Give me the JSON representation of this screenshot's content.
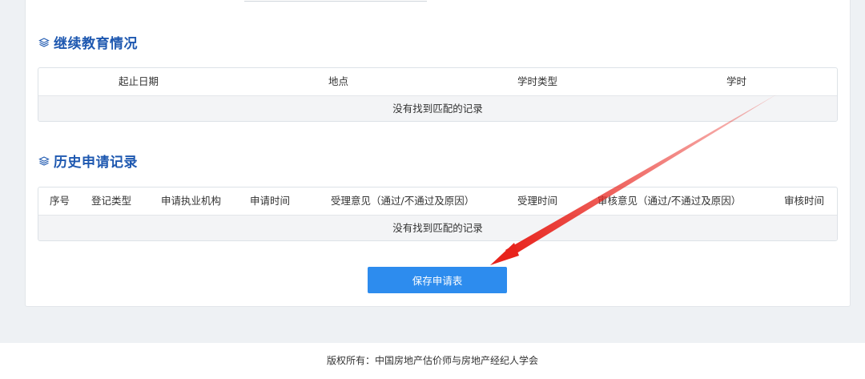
{
  "continuing_education": {
    "title": "继续教育情况",
    "columns": [
      "起止日期",
      "地点",
      "学时类型",
      "学时"
    ],
    "empty_text": "没有找到匹配的记录"
  },
  "history": {
    "title": "历史申请记录",
    "columns": [
      "序号",
      "登记类型",
      "申请执业机构",
      "申请时间",
      "受理意见（通过/不通过及原因）",
      "受理时间",
      "审核意见（通过/不通过及原因）",
      "审核时间"
    ],
    "empty_text": "没有找到匹配的记录"
  },
  "actions": {
    "save_label": "保存申请表"
  },
  "footer": {
    "copyright": "版权所有：中国房地产估价师与房地产经纪人学会"
  },
  "colors": {
    "section_title": "#1e58b0",
    "primary_button": "#2d8cee",
    "annotation_arrow": "#e8231c",
    "page_background": "#eef1f4"
  }
}
